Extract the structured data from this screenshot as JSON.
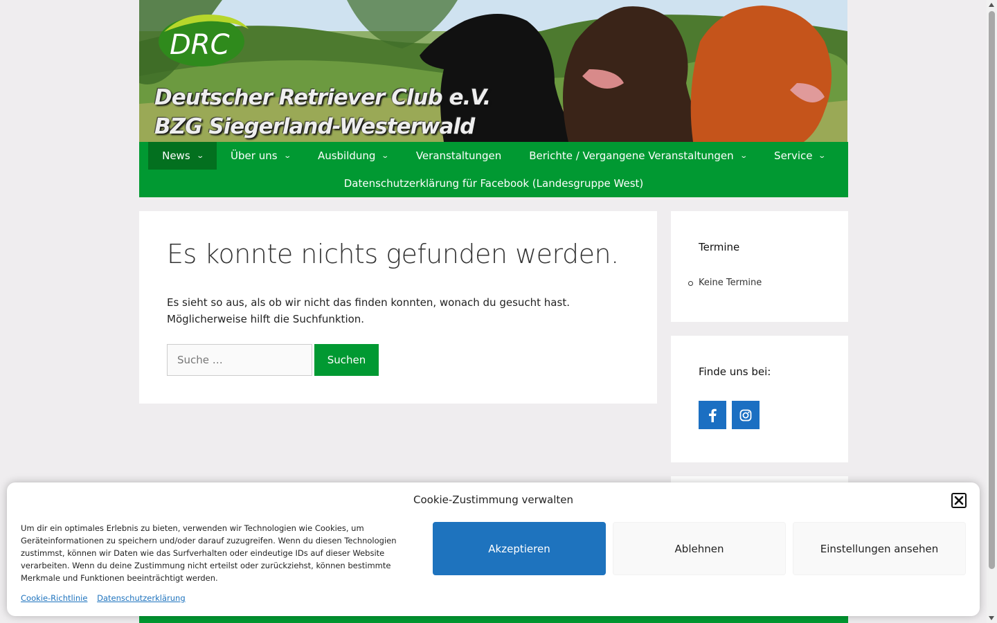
{
  "header": {
    "logo_text": "DRC",
    "title_line1": "Deutscher Retriever Club e.V.",
    "title_line2": "BZG Siegerland-Westerwald"
  },
  "nav": {
    "items": [
      {
        "label": "News",
        "dropdown": true,
        "active": true
      },
      {
        "label": "Über uns",
        "dropdown": true
      },
      {
        "label": "Ausbildung",
        "dropdown": true
      },
      {
        "label": "Veranstaltungen",
        "dropdown": false
      },
      {
        "label": "Berichte / Vergangene Veranstaltungen",
        "dropdown": true
      },
      {
        "label": "Service",
        "dropdown": true
      }
    ],
    "row2_item": "Datenschutzerklärung für Facebook (Landesgruppe West)"
  },
  "main": {
    "title": "Es konnte nichts gefunden werden.",
    "text": "Es sieht so aus, als ob wir nicht das finden konnten, wonach du gesucht hast. Möglicherweise hilft die Suchfunktion.",
    "search_placeholder": "Suche …",
    "search_button": "Suchen"
  },
  "sidebar": {
    "termine_title": "Termine",
    "termine_items": [
      "Keine Termine"
    ],
    "social_title": "Finde uns bei:",
    "social_icons": [
      "facebook-icon",
      "instagram-icon"
    ]
  },
  "cookie": {
    "title": "Cookie-Zustimmung verwalten",
    "message": "Um dir ein optimales Erlebnis zu bieten, verwenden wir Technologien wie Cookies, um Geräteinformationen zu speichern und/oder darauf zuzugreifen. Wenn du diesen Technologien zustimmst, können wir Daten wie das Surfverhalten oder eindeutige IDs auf dieser Website verarbeiten. Wenn du deine Zustimmung nicht erteilst oder zurückziehst, können bestimmte Merkmale und Funktionen beeinträchtigt werden.",
    "accept": "Akzeptieren",
    "deny": "Ablehnen",
    "settings": "Einstellungen ansehen",
    "link_policy": "Cookie-Richtlinie",
    "link_privacy": "Datenschutzerklärung"
  },
  "colors": {
    "nav_green": "#019932",
    "nav_active": "#03701f",
    "accept_blue": "#1e73be",
    "social_blue": "#1b6fc2",
    "page_bg": "#efedef"
  }
}
